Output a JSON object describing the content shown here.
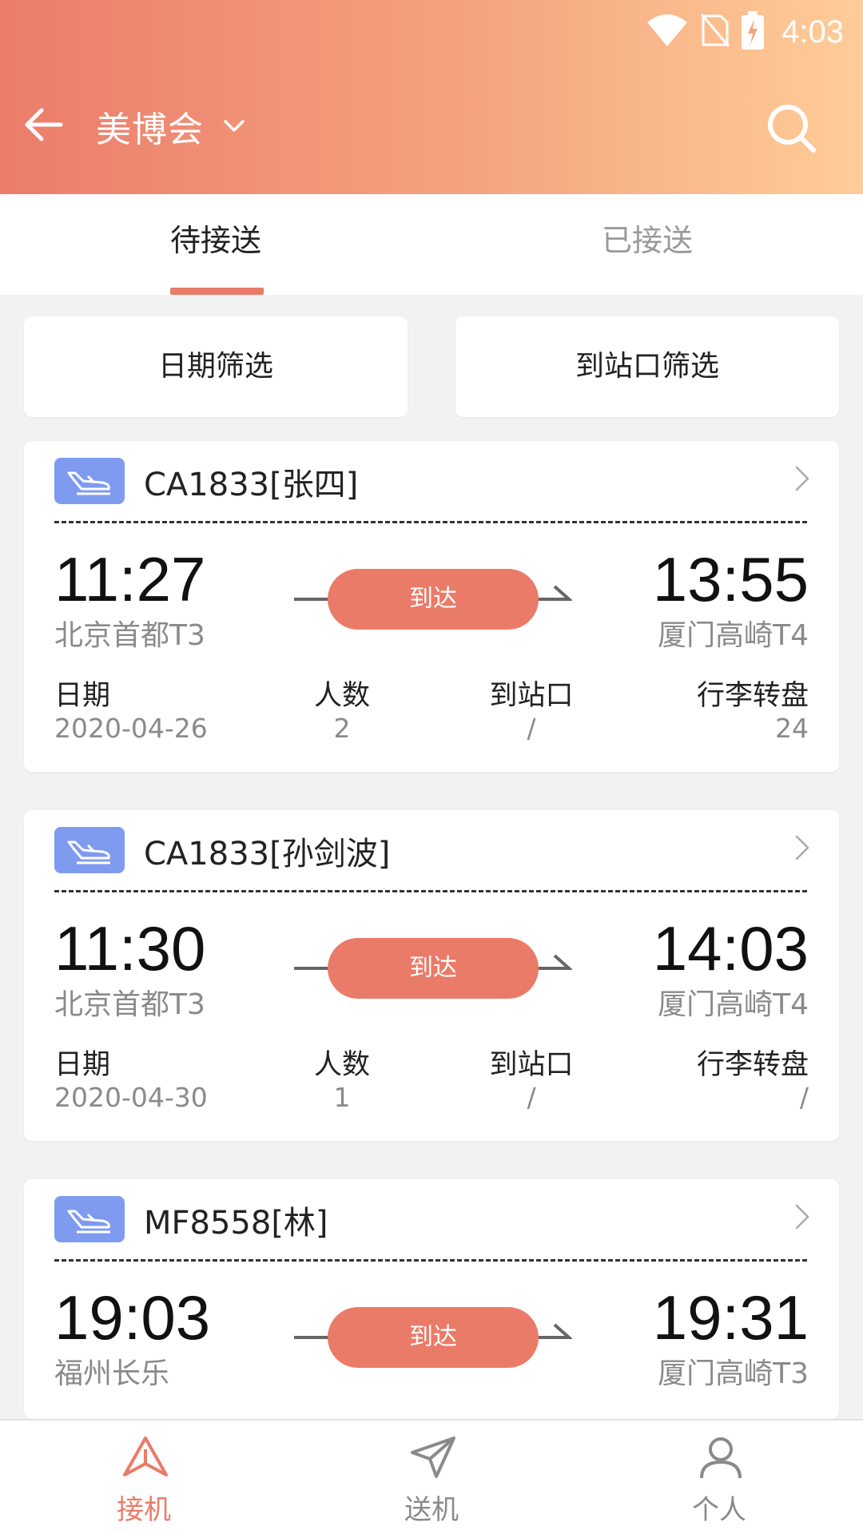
{
  "status_bar": {
    "time": "4:03",
    "icons": [
      "wifi-icon",
      "no-sim-icon",
      "battery-charging-icon"
    ]
  },
  "header": {
    "title": "美博会",
    "back_icon": "arrow-left-icon",
    "dropdown_icon": "chevron-down-icon",
    "search_icon": "search-icon"
  },
  "tabs": [
    {
      "label": "待接送",
      "active": true
    },
    {
      "label": "已接送",
      "active": false
    }
  ],
  "filters": {
    "date": "日期筛选",
    "station": "到站口筛选"
  },
  "info_labels": {
    "date": "日期",
    "people": "人数",
    "gate": "到站口",
    "baggage": "行李转盘"
  },
  "cards": [
    {
      "flight": "CA1833[张四]",
      "dep_time": "11:27",
      "dep_place": "北京首都T3",
      "arr_time": "13:55",
      "arr_place": "厦门高崎T4",
      "status": "到达",
      "date": "2020-04-26",
      "people": "2",
      "gate": "/",
      "baggage": "24"
    },
    {
      "flight": "CA1833[孙剑波]",
      "dep_time": "11:30",
      "dep_place": "北京首都T3",
      "arr_time": "14:03",
      "arr_place": "厦门高崎T4",
      "status": "到达",
      "date": "2020-04-30",
      "people": "1",
      "gate": "/",
      "baggage": "/"
    },
    {
      "flight": "MF8558[林]",
      "dep_time": "19:03",
      "dep_place": "福州长乐",
      "arr_time": "19:31",
      "arr_place": "厦门高崎T3",
      "status": "到达"
    }
  ],
  "bottom_nav": [
    {
      "label": "接机",
      "icon": "pickup-plane-icon",
      "active": true
    },
    {
      "label": "送机",
      "icon": "send-plane-icon",
      "active": false
    },
    {
      "label": "个人",
      "icon": "person-icon",
      "active": false
    }
  ],
  "colors": {
    "accent": "#ea7b68",
    "header_start": "#ec7c6b",
    "header_end": "#ffcd98",
    "badge": "#7f9bf0"
  }
}
